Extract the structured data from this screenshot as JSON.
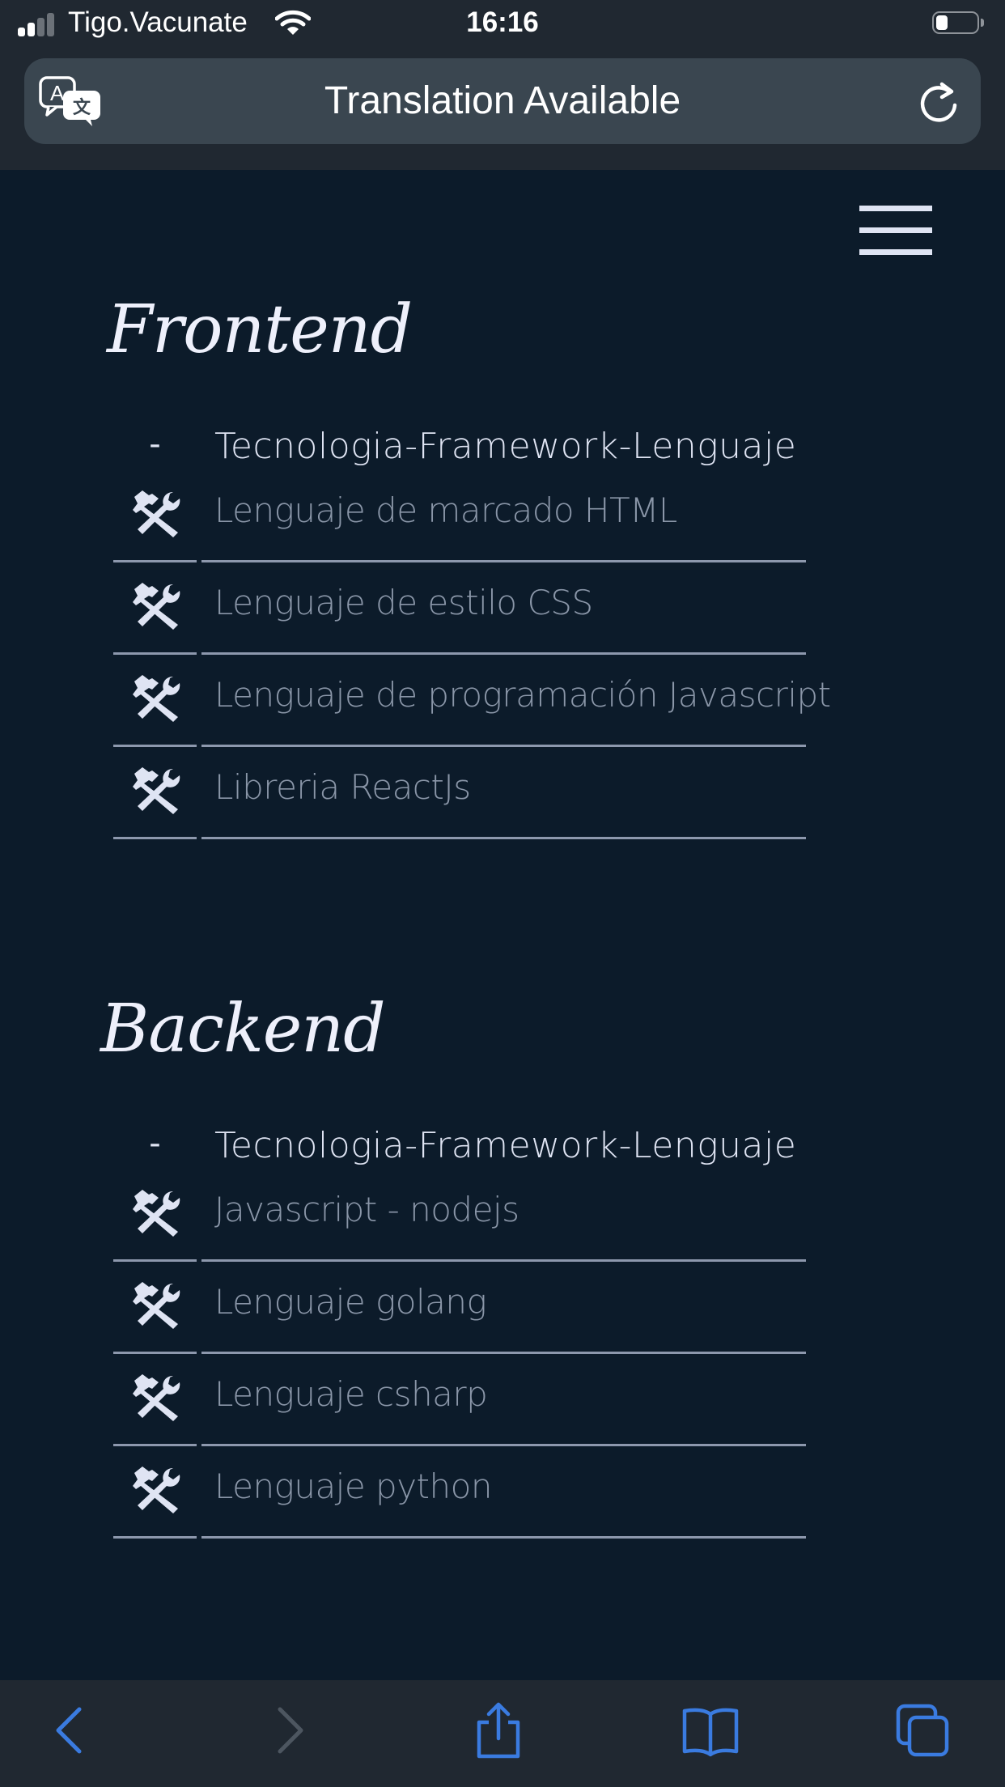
{
  "status_bar": {
    "carrier": "Tigo.Vacunate",
    "time": "16:16",
    "battery_fraction": 0.3
  },
  "browser": {
    "url_title": "Translation Available",
    "accent_color": "#3a7be0"
  },
  "icons": {
    "menu": "hamburger-icon",
    "translate": "translate-icon",
    "reload": "reload-icon",
    "row": "hammer-wrench-icon"
  },
  "sections": [
    {
      "title": "Frontend",
      "header_dash": "-",
      "header_label": "Tecnologia-Framework-Lenguaje",
      "items": [
        "Lenguaje de marcado HTML",
        "Lenguaje de estilo CSS",
        "Lenguaje de programación Javascript",
        "Libreria ReactJs"
      ]
    },
    {
      "title": "Backend",
      "header_dash": "-",
      "header_label": "Tecnologia-Framework-Lenguaje",
      "items": [
        "Javascript - nodejs",
        "Lenguaje golang",
        "Lenguaje csharp",
        "Lenguaje python"
      ]
    }
  ],
  "toolbar": {
    "back": "back-chevron-icon",
    "forward": "forward-chevron-icon",
    "share": "share-icon",
    "bookmarks": "bookmarks-book-icon",
    "tabs": "tabs-icon"
  }
}
